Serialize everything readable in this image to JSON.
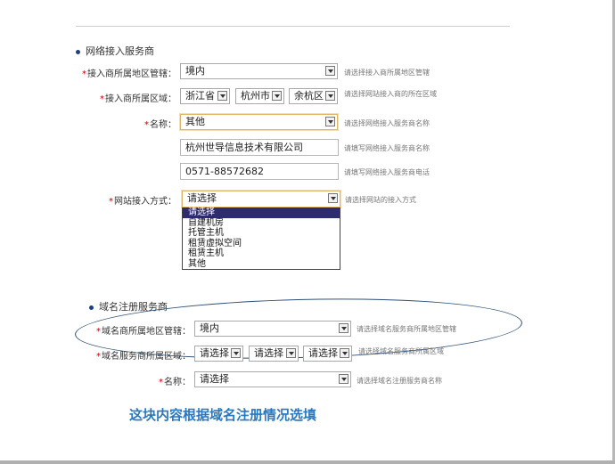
{
  "isp_section": {
    "title": "网络接入服务商",
    "region_auth": {
      "label": "接入商所属地区管辖：",
      "value": "境内",
      "hint": "请选择接入商所属地区管辖"
    },
    "region": {
      "label": "接入商所属区域：",
      "province": "浙江省",
      "city": "杭州市",
      "district": "余杭区",
      "hint": "请选择网站接入商的所在区域"
    },
    "name": {
      "label": "名称：",
      "value": "其他",
      "hint": "请选择网络接入服务商名称"
    },
    "company": {
      "value": "杭州世导信息技术有限公司",
      "hint": "请填写网络接入服务商名称"
    },
    "phone": {
      "value": "0571-88572682",
      "hint": "请填写网络接入服务商电话"
    },
    "access_method": {
      "label": "网站接入方式：",
      "value": "请选择",
      "hint": "请选择网站的接入方式",
      "options": [
        "请选择",
        "自建机房",
        "托管主机",
        "租赁虚拟空间",
        "租赁主机",
        "其他"
      ]
    }
  },
  "domain_section": {
    "title": "域名注册服务商",
    "region_auth": {
      "label": "域名商所属地区管辖：",
      "value": "境内",
      "hint": "请选择域名服务商所属地区管辖"
    },
    "region": {
      "label": "域名服务商所属区域：",
      "province": "请选择",
      "city": "请选择",
      "district": "请选择",
      "hint": "请选择域名服务商所属区域"
    },
    "name": {
      "label": "名称：",
      "value": "请选择",
      "hint": "请选择域名注册服务商名称"
    }
  },
  "annotation": "这块内容根据域名注册情况选填",
  "colors": {
    "required": "#c00000",
    "bullet": "#1a3f84",
    "highlight": "#2d2c6e",
    "annotation": "#2a78bf",
    "ellipse": "#2f4f76"
  }
}
